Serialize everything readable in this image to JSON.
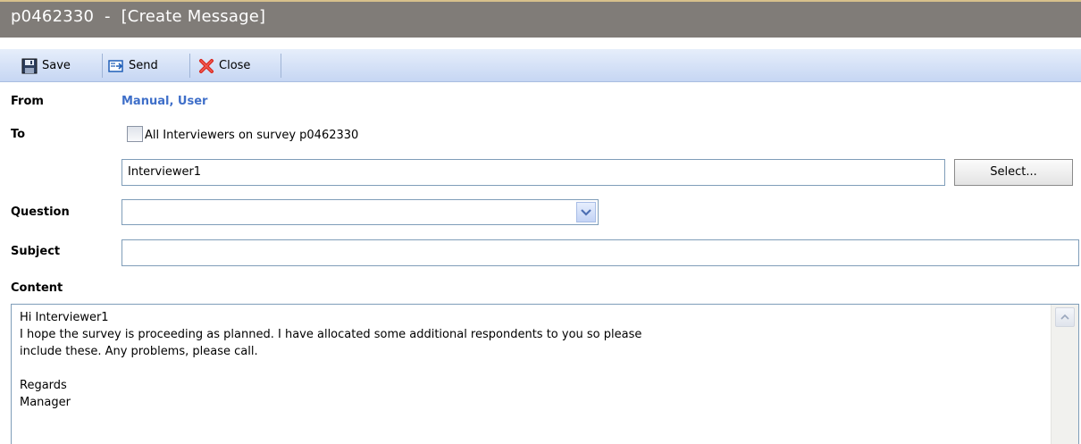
{
  "window": {
    "title": "p0462330  -  [Create Message]"
  },
  "toolbar": {
    "save_label": "Save",
    "send_label": "Send",
    "close_label": "Close"
  },
  "form": {
    "from_label": "From",
    "from_value": "Manual, User",
    "to_label": "To",
    "all_interviewers_label": "All Interviewers on survey p0462330",
    "all_interviewers_checked": false,
    "to_value": "Interviewer1",
    "select_button_label": "Select...",
    "question_label": "Question",
    "question_value": "",
    "subject_label": "Subject",
    "subject_value": "",
    "content_label": "Content",
    "content_value": "Hi Interviewer1\nI hope the survey is proceeding as planned. I have allocated some additional respondents to you so please\ninclude these. Any problems, please call.\n\nRegards\nManager"
  },
  "colors": {
    "titlebar_bg": "#807c78",
    "toolbar_bg": "#c6d6f3",
    "from_value_color": "#3f6fc9"
  }
}
